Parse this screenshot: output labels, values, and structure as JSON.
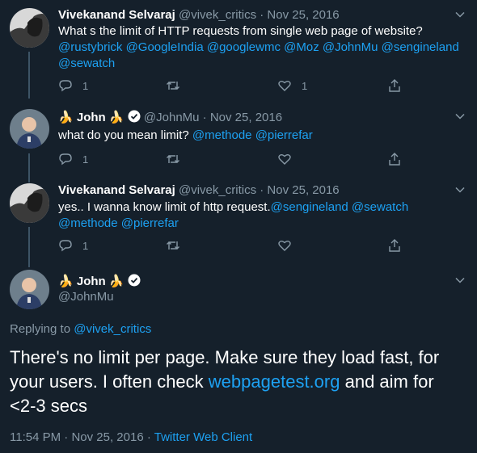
{
  "tweets": [
    {
      "name": "Vivekanand Selvaraj",
      "handle": "@vivek_critics",
      "separator": "·",
      "date": "Nov 25, 2016",
      "text_main": "What s the limit of HTTP requests from single web page of website?",
      "mentions": "@rustybrick @GoogleIndia @googlewmc @Moz @JohnMu @sengineland @sewatch",
      "reply_count": "1",
      "retweet_count": "",
      "like_count": "1"
    },
    {
      "name_prefix": "🍌",
      "name": "John",
      "name_suffix": "🍌",
      "handle": "@JohnMu",
      "separator": "·",
      "date": "Nov 25, 2016",
      "text_main": "what do you mean limit?",
      "mentions": "@methode @pierrefar",
      "reply_count": "1",
      "retweet_count": "",
      "like_count": ""
    },
    {
      "name": "Vivekanand Selvaraj",
      "handle": "@vivek_critics",
      "separator": "·",
      "date": "Nov 25, 2016",
      "text_main": "yes.. I wanna know limit of http request.",
      "mentions_inline": "@sengineland @sewatch",
      "mentions": "@methode @pierrefar",
      "reply_count": "1",
      "retweet_count": "",
      "like_count": ""
    }
  ],
  "main_tweet": {
    "name_prefix": "🍌",
    "name": "John",
    "name_suffix": "🍌",
    "handle": "@JohnMu",
    "replying_label": "Replying to",
    "replying_handle": "@vivek_critics",
    "text_before": "There's no limit per page. Make sure they load fast, for your users. I often check",
    "link_text": "webpagetest.org",
    "text_after": "and aim for <2-3 secs",
    "time": "11:54 PM",
    "separator": "·",
    "date": "Nov 25, 2016",
    "separator2": "·",
    "client": "Twitter Web Client"
  },
  "colors": {
    "background": "#15202b",
    "text": "#ffffff",
    "muted": "#8899a6",
    "accent": "#1da1f2",
    "verified": "#ffffff"
  },
  "icons": [
    "reply-icon",
    "retweet-icon",
    "like-icon",
    "share-icon",
    "chevron-down-icon",
    "verified-badge-icon"
  ]
}
